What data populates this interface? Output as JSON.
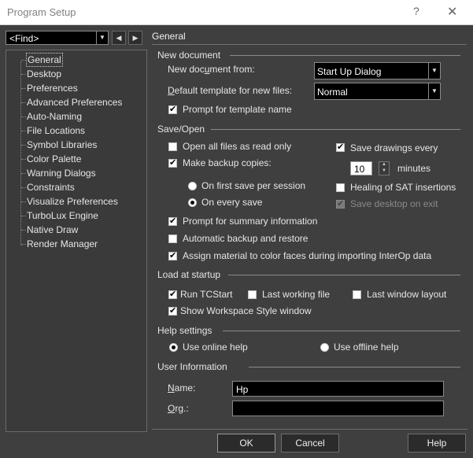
{
  "window": {
    "title": "Program Setup",
    "help_glyph": "?",
    "close_glyph": "✕"
  },
  "find": {
    "value": "<Find>"
  },
  "nav": {
    "prev": "◀",
    "next": "▶"
  },
  "tree": {
    "items": [
      {
        "label": "General",
        "selected": true
      },
      {
        "label": "Desktop"
      },
      {
        "label": "Preferences"
      },
      {
        "label": "Advanced Preferences"
      },
      {
        "label": "Auto-Naming"
      },
      {
        "label": "File Locations"
      },
      {
        "label": "Symbol Libraries"
      },
      {
        "label": "Color Palette"
      },
      {
        "label": "Warning Dialogs"
      },
      {
        "label": "Constraints"
      },
      {
        "label": "Visualize Preferences"
      },
      {
        "label": "TurboLux Engine"
      },
      {
        "label": "Native Draw"
      },
      {
        "label": "Render Manager"
      }
    ]
  },
  "panel": {
    "title": "General"
  },
  "new_document": {
    "group": "New document",
    "from_label_a": "New doc",
    "from_label_u": "u",
    "from_label_b": "ment from:",
    "from_value": "Start Up Dialog",
    "template_label_u": "D",
    "template_label_rest": "efault template for new files:",
    "template_value": "Normal",
    "prompt_template": "Prompt for template name"
  },
  "save_open": {
    "group": "Save/Open",
    "open_read_only": "Open all files as read only",
    "make_backup": "Make backup copies:",
    "on_first_save": "On first save per session",
    "on_every_save": "On every save",
    "save_drawings_every": "Save drawings every",
    "minutes_value": "10",
    "minutes_label": "minutes",
    "healing_sat": "Healing of SAT insertions",
    "save_desktop": "Save desktop on exit",
    "prompt_summary": "Prompt for summary information",
    "auto_backup": "Automatic backup and restore",
    "assign_material": "Assign material to color faces during importing InterOp data"
  },
  "load_startup": {
    "group": "Load at startup",
    "run_tcstart": "Run TCStart",
    "last_working_file": "Last working file",
    "last_window_layout": "Last window layout",
    "show_workspace": "Show Workspace Style window"
  },
  "help_settings": {
    "group": "Help settings",
    "online": "Use online help",
    "offline": "Use offline help"
  },
  "user_info": {
    "group": "User Information",
    "name_label_u": "N",
    "name_label_rest": "ame:",
    "name_value": "Hp",
    "org_label_u": "O",
    "org_label_rest": "rg.:",
    "org_value": ""
  },
  "buttons": {
    "ok": "OK",
    "cancel": "Cancel",
    "help": "Help"
  },
  "icons": {
    "dropdown": "▼",
    "spin_up": "▲",
    "spin_down": "▼"
  }
}
